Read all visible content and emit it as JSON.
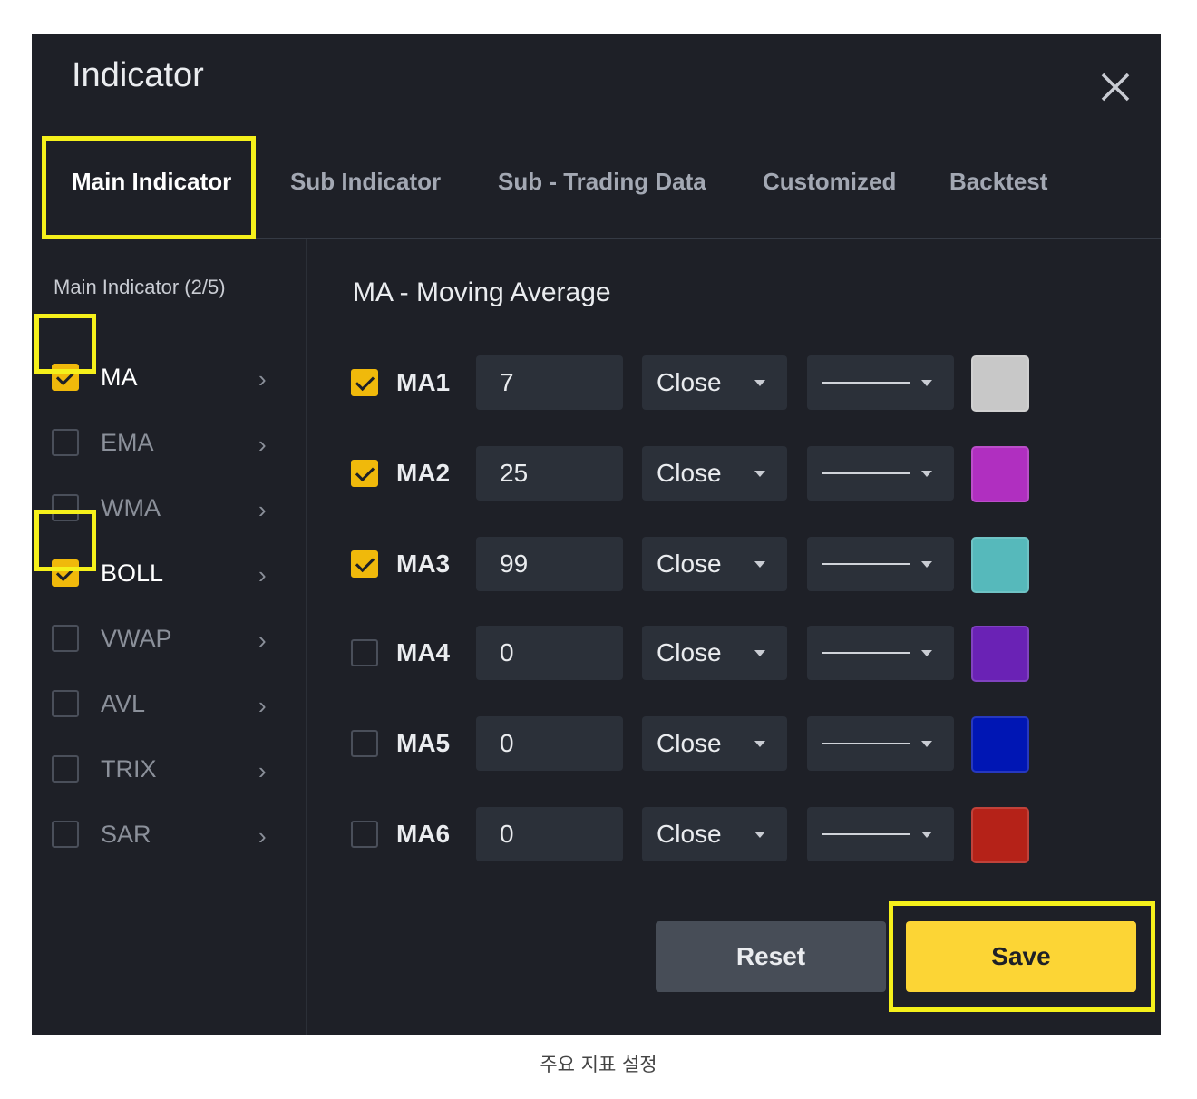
{
  "dialog": {
    "title": "Indicator",
    "close_icon": "close-icon"
  },
  "tabs": [
    {
      "label": "Main Indicator",
      "active": true
    },
    {
      "label": "Sub Indicator",
      "active": false
    },
    {
      "label": "Sub - Trading Data",
      "active": false
    },
    {
      "label": "Customized",
      "active": false
    },
    {
      "label": "Backtest",
      "active": false
    }
  ],
  "sidebar": {
    "heading": "Main Indicator (2/5)",
    "items": [
      {
        "label": "MA",
        "checked": true
      },
      {
        "label": "EMA",
        "checked": false
      },
      {
        "label": "WMA",
        "checked": false
      },
      {
        "label": "BOLL",
        "checked": true
      },
      {
        "label": "VWAP",
        "checked": false
      },
      {
        "label": "AVL",
        "checked": false
      },
      {
        "label": "TRIX",
        "checked": false
      },
      {
        "label": "SAR",
        "checked": false
      }
    ]
  },
  "panel": {
    "title": "MA - Moving Average",
    "rows": [
      {
        "label": "MA1",
        "checked": true,
        "period": "7",
        "source": "Close",
        "color": "#c8c8c8"
      },
      {
        "label": "MA2",
        "checked": true,
        "period": "25",
        "source": "Close",
        "color": "#b02fc0"
      },
      {
        "label": "MA3",
        "checked": true,
        "period": "99",
        "source": "Close",
        "color": "#56b9bb"
      },
      {
        "label": "MA4",
        "checked": false,
        "period": "0",
        "source": "Close",
        "color": "#6a22b5"
      },
      {
        "label": "MA5",
        "checked": false,
        "period": "0",
        "source": "Close",
        "color": "#0016b4"
      },
      {
        "label": "MA6",
        "checked": false,
        "period": "0",
        "source": "Close",
        "color": "#b52218"
      }
    ]
  },
  "actions": {
    "reset_label": "Reset",
    "save_label": "Save"
  },
  "caption": "주요 지표 설정",
  "colors": {
    "highlight": "#f5f01b",
    "accent": "#f0b90b",
    "background": "#1e2027"
  }
}
